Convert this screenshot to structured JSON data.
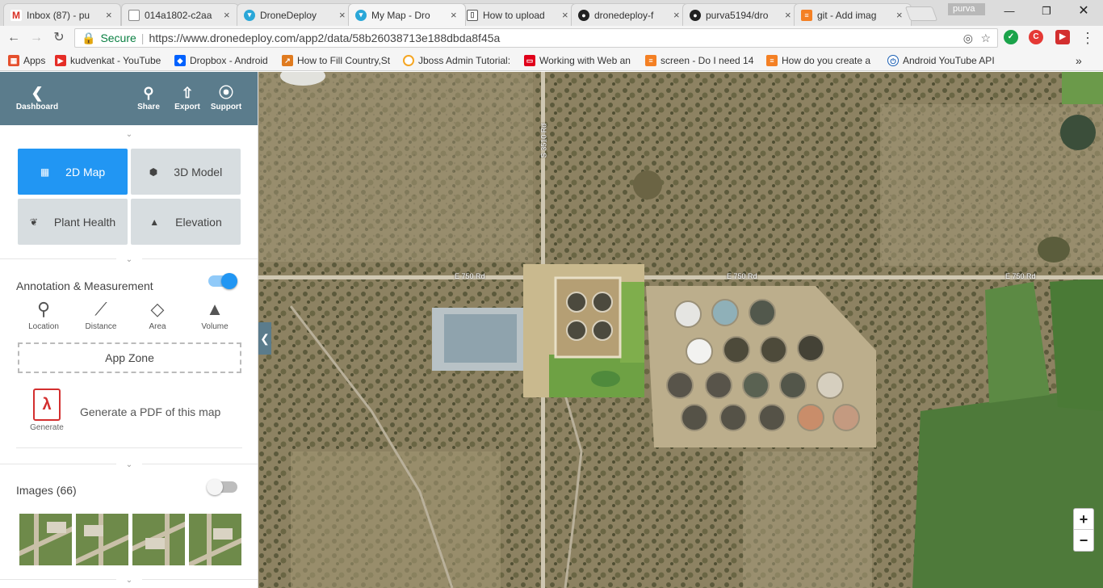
{
  "browser": {
    "tabs": [
      {
        "title": "Inbox (87) - pu",
        "icon": "gmail-icon",
        "color": "#d93025"
      },
      {
        "title": "014a1802-c2aa",
        "icon": "doc-icon",
        "color": "#888888"
      },
      {
        "title": "DroneDeploy",
        "icon": "dronedeploy-icon",
        "color": "#2aa7d8"
      },
      {
        "title": "My Map - Dro",
        "icon": "dronedeploy-icon",
        "color": "#2aa7d8"
      },
      {
        "title": "How to upload",
        "icon": "book-icon",
        "color": "#555555"
      },
      {
        "title": "dronedeploy-f",
        "icon": "github-icon",
        "color": "#222222"
      },
      {
        "title": "purva5194/dro",
        "icon": "github-icon",
        "color": "#222222"
      },
      {
        "title": "git - Add imag",
        "icon": "stackoverflow-icon",
        "color": "#f48024"
      }
    ],
    "active_tab": 3,
    "profile_name": "purva",
    "secure_label": "Secure",
    "url": "https://www.dronedeploy.com/app2/data/58b26038713e188dbda8f45a",
    "bookmarks": [
      {
        "label": "Apps",
        "icon": "apps-grid-icon",
        "color": "#e5502e"
      },
      {
        "label": "kudvenkat - YouTube",
        "icon": "youtube-icon",
        "color": "#e52d27"
      },
      {
        "label": "Dropbox - Android",
        "icon": "dropbox-icon",
        "color": "#0061fe"
      },
      {
        "label": "How to Fill Country,St",
        "icon": "bookmark-arrow-icon",
        "color": "#e07b1f"
      },
      {
        "label": "Jboss Admin Tutorial:",
        "icon": "jboss-icon",
        "color": "#f5a623"
      },
      {
        "label": "Working with Web an",
        "icon": "oracle-icon",
        "color": "#e0001a"
      },
      {
        "label": "screen - Do I need 14",
        "icon": "stackoverflow-icon",
        "color": "#f48024"
      },
      {
        "label": "How do you create a",
        "icon": "stackoverflow-icon",
        "color": "#f48024"
      },
      {
        "label": "Android YouTube API",
        "icon": "power-icon",
        "color": "#1a5fb4"
      }
    ]
  },
  "sidebar": {
    "header": {
      "back_label": "Dashboard",
      "share_label": "Share",
      "export_label": "Export",
      "support_label": "Support"
    },
    "map_types": [
      {
        "label": "2D Map",
        "icon": "map-icon",
        "active": true
      },
      {
        "label": "3D Model",
        "icon": "cube-icon",
        "active": false
      },
      {
        "label": "Plant Health",
        "icon": "leaf-icon",
        "active": false
      },
      {
        "label": "Elevation",
        "icon": "mountain-icon",
        "active": false
      }
    ],
    "annotation": {
      "title": "Annotation & Measurement",
      "enabled": true,
      "tools": [
        {
          "label": "Location",
          "icon": "location-pin-icon"
        },
        {
          "label": "Distance",
          "icon": "ruler-line-icon"
        },
        {
          "label": "Area",
          "icon": "polygon-area-icon"
        },
        {
          "label": "Volume",
          "icon": "volume-cone-icon"
        }
      ]
    },
    "app_zone_label": "App Zone",
    "pdf": {
      "icon_label": "Generate",
      "text": "Generate a PDF of this map"
    },
    "images": {
      "title": "Images (66)",
      "enabled": false
    }
  },
  "map": {
    "road_labels": [
      "E 750 Rd",
      "E 750 Rd",
      "E 750 Rd",
      "S 3510 Rd"
    ],
    "zoom_in_label": "+",
    "zoom_out_label": "−"
  },
  "colors": {
    "accent": "#2196f3",
    "header": "#5b7c8c",
    "pdf_red": "#d32f2f"
  }
}
